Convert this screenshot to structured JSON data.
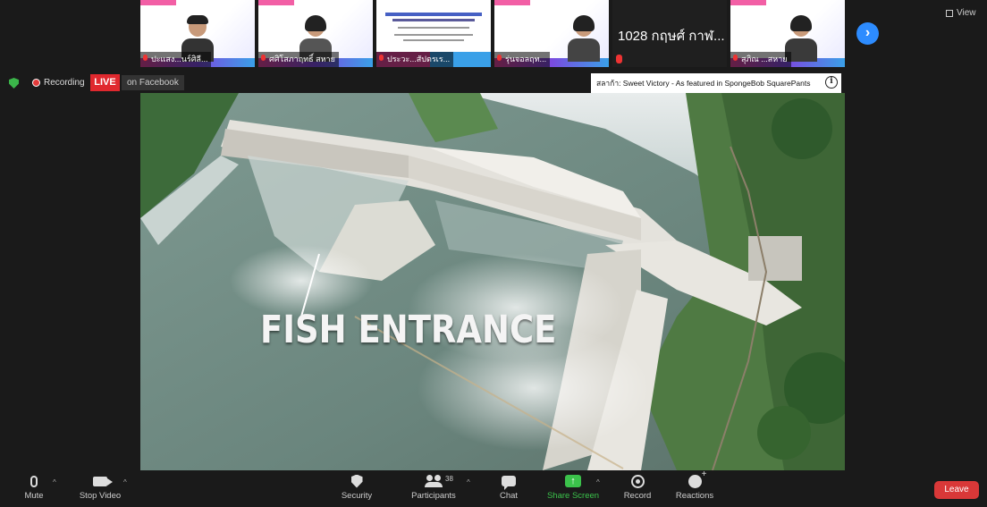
{
  "view_label": "View",
  "gallery": {
    "tiles": [
      {
        "name": "ปะแสง...นร์ศิลี...",
        "kind": "video",
        "active": true
      },
      {
        "name": "ศศิโสภาฤทธิ์ สหาย",
        "kind": "video",
        "active": false
      },
      {
        "name": "ประวะ...สัปตรเร...",
        "kind": "slide",
        "active": false
      },
      {
        "name": "รุ่นจอลฤท...",
        "kind": "video",
        "active": false
      },
      {
        "name": "1028 กฤษศ์ กาฬ...",
        "kind": "dark",
        "active": false
      },
      {
        "name": "สุภิณ ...สหาย",
        "kind": "video",
        "active": false
      }
    ],
    "next_icon": "chevron-right-icon"
  },
  "status": {
    "recording_label": "Recording",
    "live_label": "LIVE",
    "live_on": "on Facebook",
    "banner_text": "สลาก้า: Sweet Victory - As featured in SpongeBob SquarePants"
  },
  "shared_screen": {
    "caption": "FISH ENTRANCE"
  },
  "toolbar": {
    "mute": "Mute",
    "stop_video": "Stop Video",
    "security": "Security",
    "participants": "Participants",
    "participants_count": "38",
    "chat": "Chat",
    "share_screen": "Share Screen",
    "record": "Record",
    "reactions": "Reactions",
    "leave": "Leave"
  },
  "colors": {
    "live": "#e0282e",
    "share_green": "#3bc24b",
    "leave": "#d93838",
    "accent_blue": "#2d8cff"
  }
}
